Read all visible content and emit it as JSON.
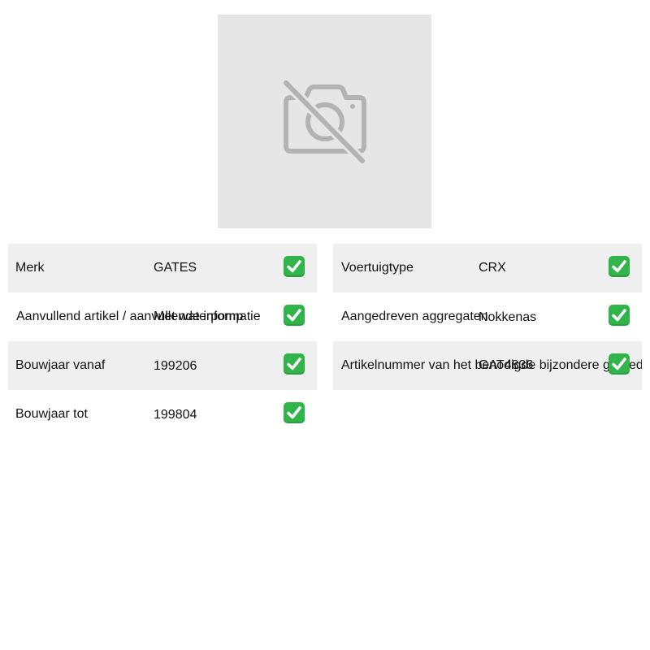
{
  "left_rows": [
    {
      "label": "Merk",
      "value": "GATES"
    },
    {
      "label": "Aanvullend artikel / aanvullende informatie",
      "value": "Met waterpomp"
    },
    {
      "label": "Bouwjaar vanaf",
      "value": "199206"
    },
    {
      "label": "Bouwjaar tot",
      "value": "199804"
    }
  ],
  "right_rows": [
    {
      "label": "Voertuigtype",
      "value": "CRX"
    },
    {
      "label": "Aangedreven aggregaten",
      "value": "Nokkenas"
    },
    {
      "label": "Artikelnummer van het benodigde bijzondere gereedschap",
      "value": "GAT4836"
    }
  ],
  "icons": {
    "placeholder": "camera-off-icon",
    "check": "check-mark-icon"
  },
  "colors": {
    "check_background": "#2fb54a",
    "row_shade": "#efefef",
    "placeholder_background": "#e6e6e6"
  }
}
